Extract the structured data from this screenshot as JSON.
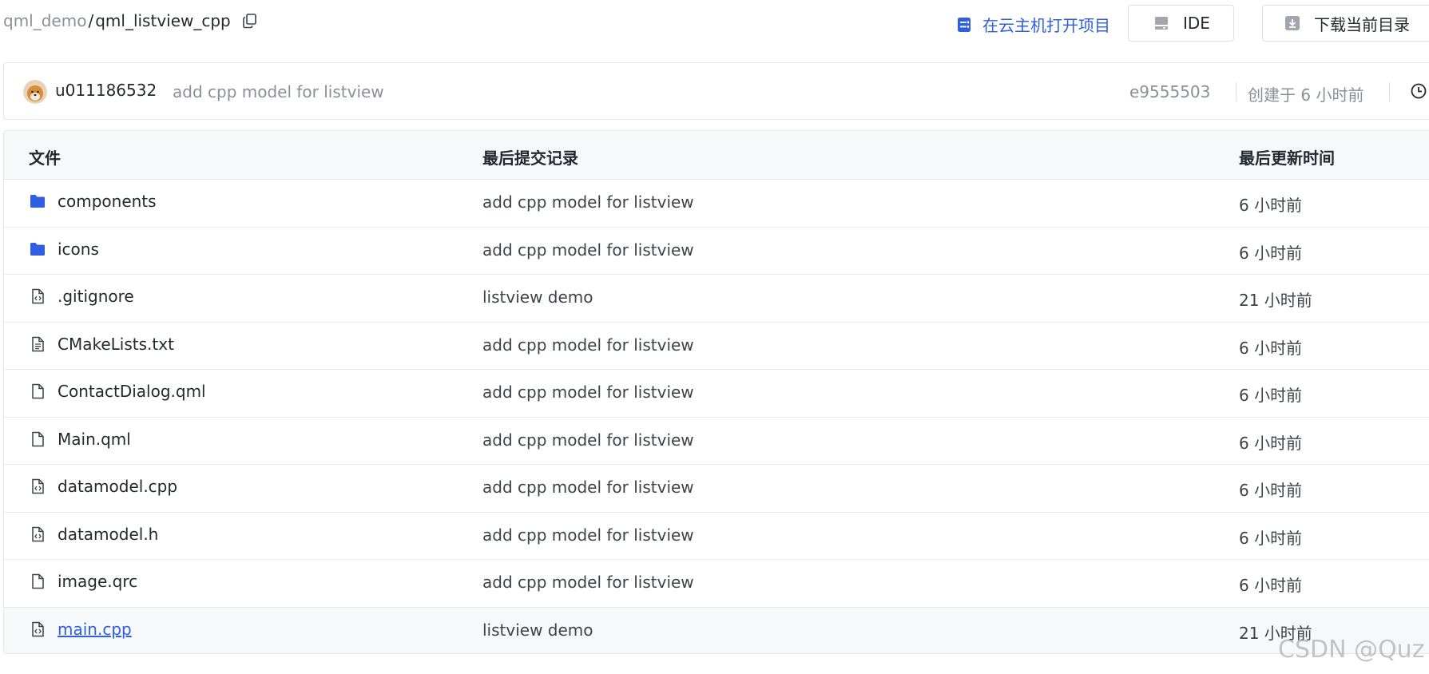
{
  "breadcrumb": {
    "parent": "qml_demo",
    "separator": "/",
    "current": "qml_listview_cpp"
  },
  "actions": {
    "open_cloud_label": "在云主机打开项目",
    "ide_label": "IDE",
    "download_label": "下载当前目录"
  },
  "commit": {
    "author": "u011186532",
    "message": "add cpp model for listview",
    "hash": "e9555503",
    "created": "创建于 6 小时前"
  },
  "table": {
    "headers": {
      "file": "文件",
      "last_commit": "最后提交记录",
      "last_updated": "最后更新时间"
    },
    "rows": [
      {
        "name": "components",
        "icon": "folder-icon",
        "commit": "add cpp model for listview",
        "time": "6 小时前"
      },
      {
        "name": "icons",
        "icon": "folder-icon",
        "commit": "add cpp model for listview",
        "time": "6 小时前"
      },
      {
        "name": ".gitignore",
        "icon": "code-file-icon",
        "commit": "listview demo",
        "time": "21 小时前"
      },
      {
        "name": "CMakeLists.txt",
        "icon": "text-file-icon",
        "commit": "add cpp model for listview",
        "time": "6 小时前"
      },
      {
        "name": "ContactDialog.qml",
        "icon": "file-icon",
        "commit": "add cpp model for listview",
        "time": "6 小时前"
      },
      {
        "name": "Main.qml",
        "icon": "file-icon",
        "commit": "add cpp model for listview",
        "time": "6 小时前"
      },
      {
        "name": "datamodel.cpp",
        "icon": "code-file-icon",
        "commit": "add cpp model for listview",
        "time": "6 小时前"
      },
      {
        "name": "datamodel.h",
        "icon": "code-file-icon",
        "commit": "add cpp model for listview",
        "time": "6 小时前"
      },
      {
        "name": "image.qrc",
        "icon": "file-icon",
        "commit": "add cpp model for listview",
        "time": "6 小时前"
      },
      {
        "name": "main.cpp",
        "icon": "code-file-icon",
        "commit": "listview demo",
        "time": "21 小时前"
      }
    ]
  },
  "watermark": "CSDN @Quz",
  "colors": {
    "accent": "#2f5fe0",
    "folder": "#2f5fe0",
    "muted_text": "#8a8f99",
    "header_bg": "#f7f8fa",
    "border": "#e3e6eb"
  }
}
